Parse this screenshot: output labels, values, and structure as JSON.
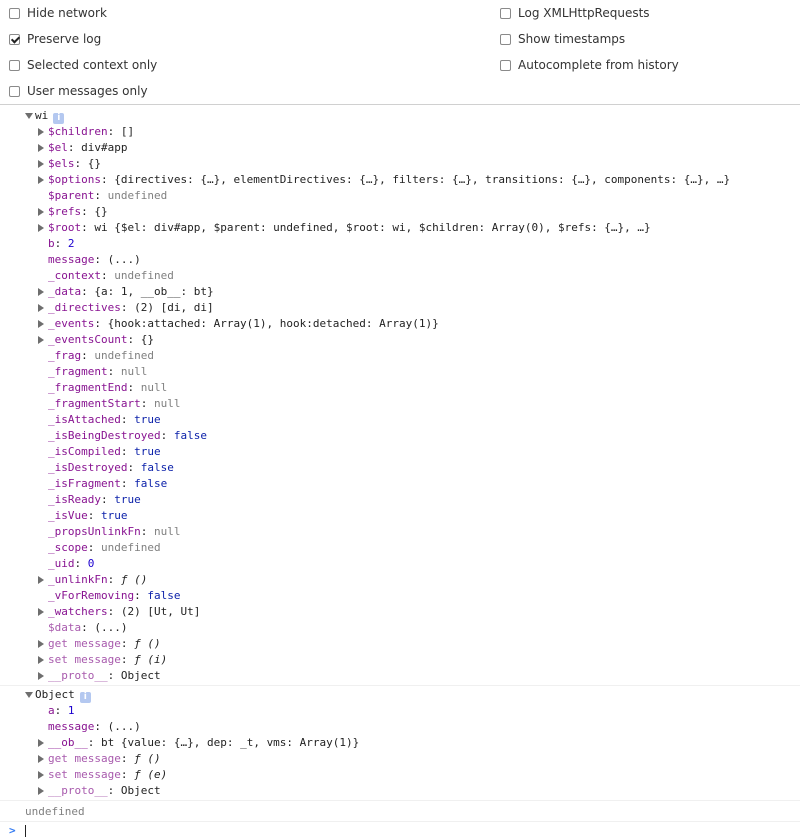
{
  "settings": {
    "left": [
      {
        "label": "Hide network",
        "checked": false
      },
      {
        "label": "Preserve log",
        "checked": true
      },
      {
        "label": "Selected context only",
        "checked": false
      },
      {
        "label": "User messages only",
        "checked": false
      }
    ],
    "right": [
      {
        "label": "Log XMLHttpRequests",
        "checked": false
      },
      {
        "label": "Show timestamps",
        "checked": false
      },
      {
        "label": "Autocomplete from history",
        "checked": false
      }
    ]
  },
  "messages": [
    {
      "header": "wi",
      "info_icon": "info-icon",
      "props": [
        {
          "key": "$children",
          "val": "[]",
          "type": "str",
          "expandable": true,
          "dim": false
        },
        {
          "key": "$el",
          "val": "div#app",
          "type": "own",
          "expandable": true,
          "dim": false
        },
        {
          "key": "$els",
          "val": "{}",
          "type": "str",
          "expandable": true,
          "dim": false
        },
        {
          "key": "$options",
          "val": "{directives: {…}, elementDirectives: {…}, filters: {…}, transitions: {…}, components: {…}, …}",
          "type": "str",
          "expandable": true,
          "dim": false
        },
        {
          "key": "$parent",
          "val": "undefined",
          "type": "undef",
          "expandable": false,
          "dim": false
        },
        {
          "key": "$refs",
          "val": "{}",
          "type": "str",
          "expandable": true,
          "dim": false
        },
        {
          "key": "$root",
          "val": "wi {$el: div#app, $parent: undefined, $root: wi, $children: Array(0), $refs: {…}, …}",
          "type": "root",
          "expandable": true,
          "dim": false
        },
        {
          "key": "b",
          "val": "2",
          "type": "num",
          "expandable": false,
          "dim": false
        },
        {
          "key": "message",
          "val": "(...)",
          "type": "str",
          "expandable": false,
          "dim": false
        },
        {
          "key": "_context",
          "val": "undefined",
          "type": "undef",
          "expandable": false,
          "dim": false
        },
        {
          "key": "_data",
          "val": "{a: 1, __ob__: bt}",
          "type": "str",
          "expandable": true,
          "dim": false
        },
        {
          "key": "_directives",
          "val": "(2) [di, di]",
          "type": "str",
          "expandable": true,
          "dim": false
        },
        {
          "key": "_events",
          "val": "{hook:attached: Array(1), hook:detached: Array(1)}",
          "type": "str",
          "expandable": true,
          "dim": false
        },
        {
          "key": "_eventsCount",
          "val": "{}",
          "type": "str",
          "expandable": true,
          "dim": false
        },
        {
          "key": "_frag",
          "val": "undefined",
          "type": "undef",
          "expandable": false,
          "dim": false
        },
        {
          "key": "_fragment",
          "val": "null",
          "type": "undef",
          "expandable": false,
          "dim": false
        },
        {
          "key": "_fragmentEnd",
          "val": "null",
          "type": "undef",
          "expandable": false,
          "dim": false
        },
        {
          "key": "_fragmentStart",
          "val": "null",
          "type": "undef",
          "expandable": false,
          "dim": false
        },
        {
          "key": "_isAttached",
          "val": "true",
          "type": "bool",
          "expandable": false,
          "dim": false
        },
        {
          "key": "_isBeingDestroyed",
          "val": "false",
          "type": "bool",
          "expandable": false,
          "dim": false
        },
        {
          "key": "_isCompiled",
          "val": "true",
          "type": "bool",
          "expandable": false,
          "dim": false
        },
        {
          "key": "_isDestroyed",
          "val": "false",
          "type": "bool",
          "expandable": false,
          "dim": false
        },
        {
          "key": "_isFragment",
          "val": "false",
          "type": "bool",
          "expandable": false,
          "dim": false
        },
        {
          "key": "_isReady",
          "val": "true",
          "type": "bool",
          "expandable": false,
          "dim": false
        },
        {
          "key": "_isVue",
          "val": "true",
          "type": "bool",
          "expandable": false,
          "dim": false
        },
        {
          "key": "_propsUnlinkFn",
          "val": "null",
          "type": "undef",
          "expandable": false,
          "dim": false
        },
        {
          "key": "_scope",
          "val": "undefined",
          "type": "undef",
          "expandable": false,
          "dim": false
        },
        {
          "key": "_uid",
          "val": "0",
          "type": "num",
          "expandable": false,
          "dim": false
        },
        {
          "key": "_unlinkFn",
          "val": "ƒ ()",
          "type": "fn",
          "expandable": true,
          "dim": false
        },
        {
          "key": "_vForRemoving",
          "val": "false",
          "type": "bool",
          "expandable": false,
          "dim": false
        },
        {
          "key": "_watchers",
          "val": "(2) [Ut, Ut]",
          "type": "str",
          "expandable": true,
          "dim": false
        },
        {
          "key": "$data",
          "val": "(...)",
          "type": "str",
          "expandable": false,
          "dim": true
        },
        {
          "key": "get message",
          "val": "ƒ ()",
          "type": "fn",
          "expandable": true,
          "dim": true
        },
        {
          "key": "set message",
          "val": "ƒ (i)",
          "type": "fn",
          "expandable": true,
          "dim": true
        },
        {
          "key": "__proto__",
          "val": "Object",
          "type": "str",
          "expandable": true,
          "dim": true
        }
      ]
    },
    {
      "header": "Object",
      "info_icon": "info-icon",
      "props": [
        {
          "key": "a",
          "val": "1",
          "type": "num",
          "expandable": false,
          "dim": false
        },
        {
          "key": "message",
          "val": "(...)",
          "type": "str",
          "expandable": false,
          "dim": false
        },
        {
          "key": "__ob__",
          "val": "bt {value: {…}, dep: _t, vms: Array(1)}",
          "type": "str",
          "expandable": true,
          "dim": false
        },
        {
          "key": "get message",
          "val": "ƒ ()",
          "type": "fn",
          "expandable": true,
          "dim": true
        },
        {
          "key": "set message",
          "val": "ƒ (e)",
          "type": "fn",
          "expandable": true,
          "dim": true
        },
        {
          "key": "__proto__",
          "val": "Object",
          "type": "str",
          "expandable": true,
          "dim": true
        }
      ]
    }
  ],
  "result": "undefined",
  "prompt": {
    "chevron": ">",
    "value": ""
  }
}
